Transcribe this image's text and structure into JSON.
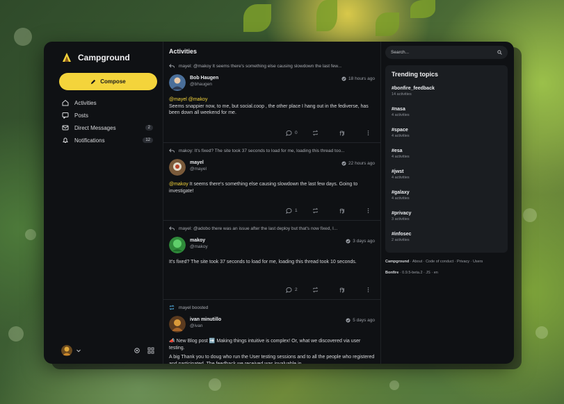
{
  "app": {
    "title": "Campground"
  },
  "sidebar": {
    "compose_label": "Compose",
    "items": [
      {
        "label": "Activities",
        "icon": "home-icon"
      },
      {
        "label": "Posts",
        "icon": "posts-icon"
      },
      {
        "label": "Direct Messages",
        "icon": "mail-icon",
        "badge": "2"
      },
      {
        "label": "Notifications",
        "icon": "bell-icon",
        "badge": "12"
      }
    ]
  },
  "feed": {
    "title": "Activities",
    "posts": [
      {
        "context": "mayel: @makoy It seems there's something else causing slowdown the last few...",
        "name": "Bob Haugen",
        "handle": "@bhaugen",
        "time": "18 hours ago",
        "mention": "@mayel @makoy",
        "text": "Seems snappier now, to me, but social.coop , the other place I hang out in the fediverse, has been down all weekend for me.",
        "replies": "0"
      },
      {
        "context": "makoy: It's fixed? The site took 37 seconds to load for me, loading this thread too...",
        "name": "mayel",
        "handle": "@mayel",
        "time": "22 hours ago",
        "mention": "@makoy",
        "text": " It seems there's something else causing slowdown the last few days. Going to investigate!",
        "replies": "1"
      },
      {
        "context": "mayel: @adobo there was an issue after the last deploy but that's now fixed, I...",
        "name": "makoy",
        "handle": "@makoy",
        "time": "3 days ago",
        "text": "It's fixed? The site took 37 seconds to load for me, loading this thread took 10 seconds.",
        "replies": "2"
      },
      {
        "context": "mayel boosted",
        "name": "ivan minutillo",
        "handle": "@ivan",
        "time": "5 days ago",
        "text": "📣 New Blog post ➡️ Making things intuitive is complex! Or, what we discovered via user testing.",
        "text2": "A big Thank you to doug who run the User testing sessions and to all the people who registered and participated. The feedback we received was invaluable in"
      }
    ]
  },
  "search": {
    "placeholder": "Search..."
  },
  "trending": {
    "title": "Trending topics",
    "topics": [
      {
        "tag": "#bonfire_feedback",
        "count": "14 activities"
      },
      {
        "tag": "#nasa",
        "count": "4 activities"
      },
      {
        "tag": "#space",
        "count": "4 activities"
      },
      {
        "tag": "#esa",
        "count": "4 activities"
      },
      {
        "tag": "#jwst",
        "count": "4 activities"
      },
      {
        "tag": "#galaxy",
        "count": "4 activities"
      },
      {
        "tag": "#privacy",
        "count": "3 activities"
      },
      {
        "tag": "#infosec",
        "count": "2 activities"
      }
    ]
  },
  "footer": {
    "instance": "Campground",
    "links": "· About · Code of conduct · Privacy · Users",
    "software": "Bonfire",
    "version": "· 0.9.5-beta.2 · JS · en"
  },
  "colors": {
    "accent": "#f4d43b",
    "panel": "#0f1114"
  }
}
